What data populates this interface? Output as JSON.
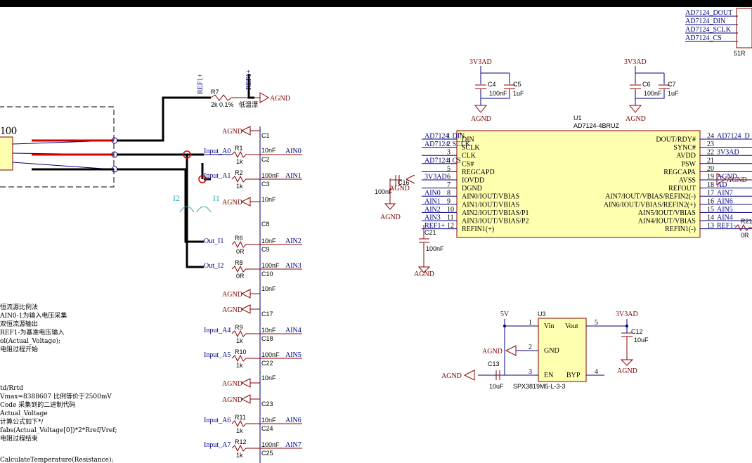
{
  "connector": {
    "label": "100"
  },
  "digital_nets": [
    "AD7124_DOUT",
    "AD7124_DIN",
    "AD7124_SCLK",
    "AD7124_CS"
  ],
  "digital_resistor": "51R",
  "ref_net": "REF1+",
  "ref_net2": "REF1-",
  "ref_resistor": {
    "designator": "R7",
    "value": "2k 0.1%",
    "note": "低温漂"
  },
  "agnd": "AGND",
  "vcc_33": "3V3AD",
  "vcc_5": "5V",
  "left_nets": {
    "input_a0": "Input_A0",
    "input_a1": "Input_A1",
    "out_i1": "Out_I1",
    "out_i2": "Out_I2",
    "input_a4": "Input_A4",
    "input_a5": "Input_A5",
    "input_a6": "Input_A6",
    "input_a7": "Input_A7"
  },
  "resistors": {
    "r1": "R1",
    "r2": "R2",
    "r6": "R6",
    "r8": "R8",
    "r9": "R9",
    "r10": "R10",
    "r11": "R11",
    "r12": "R12",
    "v1k": "1k",
    "v0r": "0R"
  },
  "caps": {
    "c1": "C1",
    "c2": "C2",
    "c3": "C3",
    "c8": "C8",
    "c9": "C9",
    "c10": "C10",
    "c17": "C17",
    "c18": "C18",
    "c22": "C22",
    "c23": "C23",
    "c24": "C24",
    "c25": "C25",
    "c4": "C4",
    "c5": "C5",
    "c6": "C6",
    "c7": "C7",
    "c16": "C16",
    "c21": "C21",
    "c12": "C12",
    "c13": "C13",
    "v10nf": "10nF",
    "v100nf": "100nF",
    "v1uf": "1uF",
    "v10uf": "10uF"
  },
  "ain_labels": [
    "AIN0",
    "AIN1",
    "AIN2",
    "AIN3",
    "AIN4",
    "AIN5",
    "AIN6",
    "AIN7"
  ],
  "currents": {
    "i1": "I1",
    "i2": "I2"
  },
  "u1": {
    "designator": "U1",
    "part": "AD7124-4BRUZ",
    "left_pins": [
      {
        "num": "1",
        "name": "DIN",
        "net": "AD7124_DIN"
      },
      {
        "num": "2",
        "name": "SCLK",
        "net": "AD7124_SCLK"
      },
      {
        "num": "3",
        "name": "CLK",
        "net": ""
      },
      {
        "num": "4",
        "name": "CS#",
        "net": "AD7124_CS"
      },
      {
        "num": "5",
        "name": "REGCAPD",
        "net": ""
      },
      {
        "num": "6",
        "name": "IOVDD",
        "net": "3V3AD"
      },
      {
        "num": "7",
        "name": "DGND",
        "net": ""
      },
      {
        "num": "8",
        "name": "AIN0/IOUT/VBIAS",
        "net": "AIN0"
      },
      {
        "num": "9",
        "name": "AIN1/IOUT/VBIAS",
        "net": "AIN1"
      },
      {
        "num": "10",
        "name": "AIN2/IOUT/VBIAS/P1",
        "net": "AIN2"
      },
      {
        "num": "11",
        "name": "AIN3/IOUT/VBIAS/P2",
        "net": "AIN3"
      },
      {
        "num": "12",
        "name": "REFIN1(+)",
        "net": "REF1+"
      }
    ],
    "right_pins": [
      {
        "num": "24",
        "name": "DOUT/RDY#",
        "net": "AD7124_D"
      },
      {
        "num": "23",
        "name": "SYNC#",
        "net": ""
      },
      {
        "num": "22",
        "name": "AVDD",
        "net": "3V3AD"
      },
      {
        "num": "21",
        "name": "PSW",
        "net": ""
      },
      {
        "num": "20",
        "name": "REGCAPA",
        "net": ""
      },
      {
        "num": "19",
        "name": "AVSS",
        "net": "AGND"
      },
      {
        "num": "18",
        "name": "REFOUT",
        "net": "AD"
      },
      {
        "num": "17",
        "name": "AIN7/IOUT/VBIAS/REFIN2(-)",
        "net": "AIN7"
      },
      {
        "num": "16",
        "name": "AIN6/IOUT/VBIAS/REFIN2(+)",
        "net": "AIN6"
      },
      {
        "num": "15",
        "name": "AIN5/IOUT/VBIAS",
        "net": "AIN5"
      },
      {
        "num": "14",
        "name": "AIN4/IOUT/VBIAS",
        "net": "AIN4"
      },
      {
        "num": "13",
        "name": "REFIN1(-)",
        "net": "REF1-"
      }
    ]
  },
  "r21": {
    "designator": "R21",
    "value": "0R"
  },
  "u3": {
    "designator": "U3",
    "part": "SPX3819M5-L-3-3",
    "pins": [
      {
        "num": "1",
        "name": "Vin"
      },
      {
        "num": "2",
        "name": "GND"
      },
      {
        "num": "3",
        "name": "EN"
      },
      {
        "num": "5",
        "name": "Vout"
      },
      {
        "num": "4",
        "name": "BYP"
      }
    ]
  },
  "code_notes": [
    "恒流源比例法",
    "AIN0-1为输入电压采集",
    "双恒流源输出",
    "REF1-为基准电压输入",
    "ol(Actual_Voltage);",
    "电阻过程开始",
    "",
    "",
    "td/Rrtd",
    "Vmax=8388607 比例等价于2500mV",
    "Code 采集到的二进制代码",
    "Actual_Voltage",
    "计算公式如下*/",
    "fabs(Actual_Voltage[0])*2*Rref/Vref;",
    "电阻过程结束",
    "",
    "",
    "CalculateTemperature(Resistance);"
  ]
}
